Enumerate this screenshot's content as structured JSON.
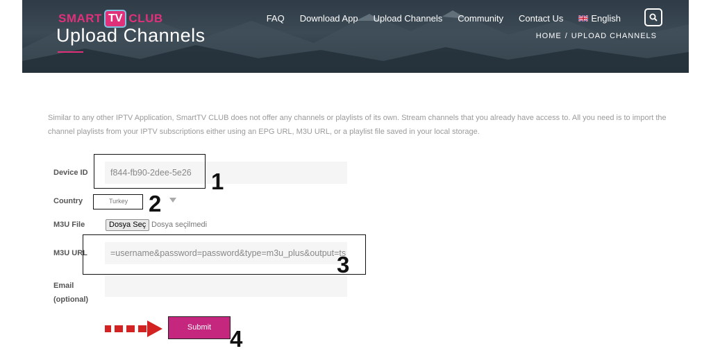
{
  "header": {
    "logo": {
      "part1": "SMART",
      "part2": "TV",
      "part3": "CLUB"
    },
    "page_title": "Upload Channels",
    "nav": [
      "FAQ",
      "Download App",
      "Upload Channels",
      "Community",
      "Contact Us"
    ],
    "language": "English",
    "breadcrumb": {
      "home": "HOME",
      "separator": "/",
      "current": "UPLOAD CHANNELS"
    }
  },
  "intro_text": "Similar to any other IPTV Application, SmartTV CLUB does not offer any channels or playlists of its own. Stream channels that you already have access to. All you need is to import the channel playlists from your IPTV subscriptions either using an EPG URL, M3U URL, or a playlist file saved in your local storage.",
  "form": {
    "device_id": {
      "label": "Device ID",
      "value": "f844-fb90-2dee-5e26"
    },
    "country": {
      "label": "Country",
      "value": "Turkey"
    },
    "m3u_file": {
      "label": "M3U File",
      "button": "Dosya Seç",
      "status": "Dosya seçilmedi"
    },
    "m3u_url": {
      "label": "M3U URL",
      "value": "=username&password=password&type=m3u_plus&output=ts"
    },
    "email": {
      "label_line1": "Email",
      "label_line2": "(optional)",
      "value": ""
    },
    "submit": "Submit"
  },
  "annotations": [
    "1",
    "2",
    "3",
    "4"
  ],
  "colors": {
    "brand": "#e0307a",
    "submit": "#c5267e",
    "arrow": "#d32222",
    "header_bg": "#2f3c47"
  }
}
